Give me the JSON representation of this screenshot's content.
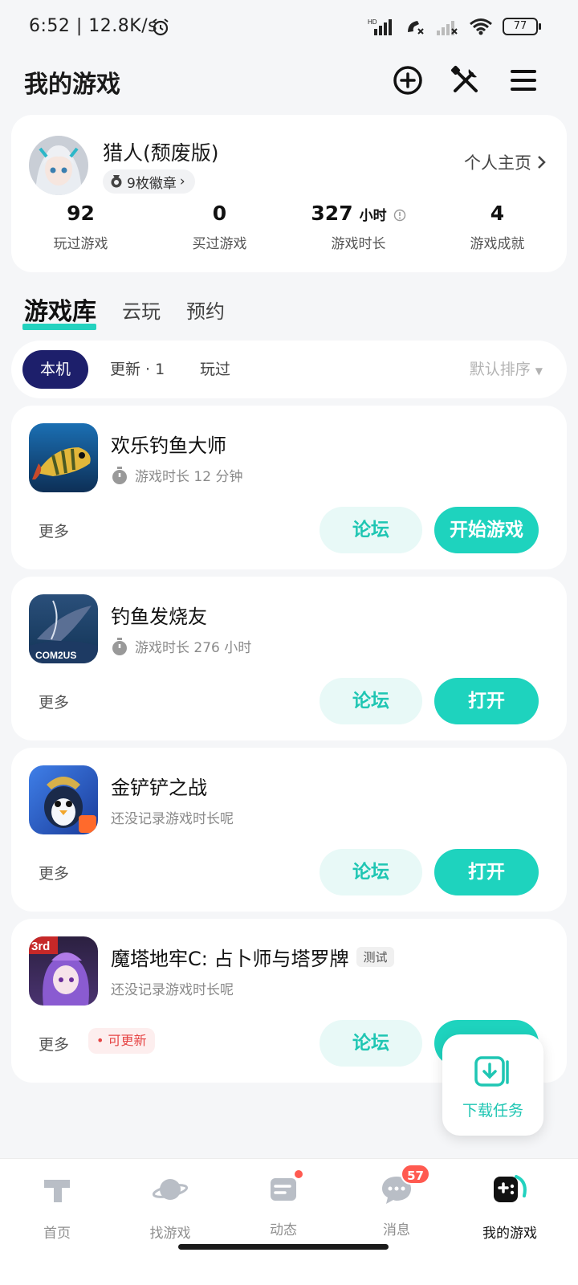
{
  "status_bar": {
    "time": "6:52 | 12.8K/s",
    "battery": "77"
  },
  "header": {
    "title": "我的游戏"
  },
  "profile": {
    "username": "猎人(颓废版)",
    "badge": "9枚徽章",
    "homepage_link": "个人主页",
    "stats": [
      {
        "value": "92",
        "unit": "",
        "label": "玩过游戏"
      },
      {
        "value": "0",
        "unit": "",
        "label": "买过游戏"
      },
      {
        "value": "327",
        "unit": "小时",
        "label": "游戏时长"
      },
      {
        "value": "4",
        "unit": "",
        "label": "游戏成就"
      }
    ]
  },
  "tabs": [
    "游戏库",
    "云玩",
    "预约"
  ],
  "filters": {
    "chips": [
      "本机",
      "更新 · 1",
      "玩过"
    ],
    "sort": "默认排序"
  },
  "games": [
    {
      "title": "欢乐钓鱼大师",
      "subtitle": "游戏时长 12 分钟",
      "more": "更多",
      "forum": "论坛",
      "action": "开始游戏"
    },
    {
      "title": "钓鱼发烧友",
      "subtitle": "游戏时长 276 小时",
      "more": "更多",
      "forum": "论坛",
      "action": "打开",
      "icon_text": "COM2US"
    },
    {
      "title": "金铲铲之战",
      "subtitle": "还没记录游戏时长呢",
      "more": "更多",
      "forum": "论坛",
      "action": "打开"
    },
    {
      "title": "魔塔地牢C: 占卜师与塔罗牌",
      "tag": "测试",
      "subtitle": "还没记录游戏时长呢",
      "more": "更多",
      "update_tag": "可更新",
      "forum": "论坛",
      "action": "",
      "icon_text": "3rd"
    }
  ],
  "download_fab": {
    "label": "下载任务"
  },
  "bottom_nav": [
    {
      "label": "首页"
    },
    {
      "label": "找游戏"
    },
    {
      "label": "动态"
    },
    {
      "label": "消息",
      "badge": "57"
    },
    {
      "label": "我的游戏"
    }
  ],
  "colors": {
    "accent": "#1ed3be",
    "chip_active": "#1d1f6b",
    "badge": "#ff5a50"
  }
}
